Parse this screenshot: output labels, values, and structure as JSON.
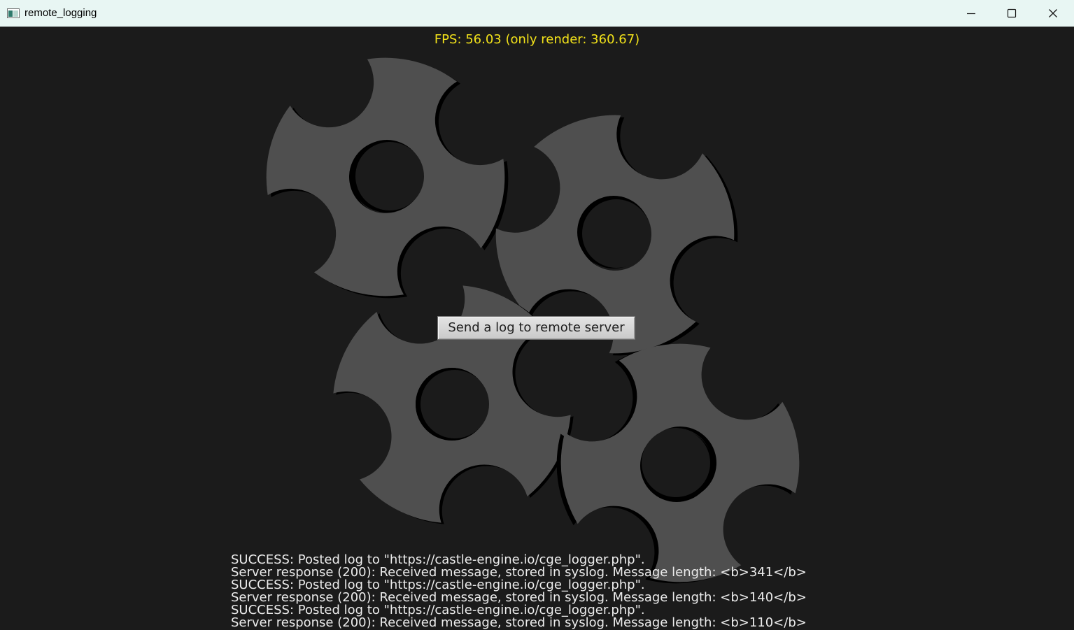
{
  "window": {
    "title": "remote_logging",
    "controls": [
      "minimize",
      "maximize",
      "close"
    ]
  },
  "overlay": {
    "fps": "FPS: 56.03 (only render: 360.67)",
    "fps_color": "#f2e21a"
  },
  "button": {
    "label": "Send a log to remote server"
  },
  "log": {
    "lines": [
      "SUCCESS: Posted log to \"https://castle-engine.io/cge_logger.php\".",
      "Server response (200): Received message, stored in syslog. Message length: <b>341</b>",
      "SUCCESS: Posted log to \"https://castle-engine.io/cge_logger.php\".",
      "Server response (200): Received message, stored in syslog. Message length: <b>140</b>",
      "SUCCESS: Posted log to \"https://castle-engine.io/cge_logger.php\".",
      "Server response (200): Received message, stored in syslog. Message length: <b>110</b>"
    ]
  },
  "scene": {
    "gear_color": "#4f4f4f",
    "background_color": "#1b1b1b"
  }
}
